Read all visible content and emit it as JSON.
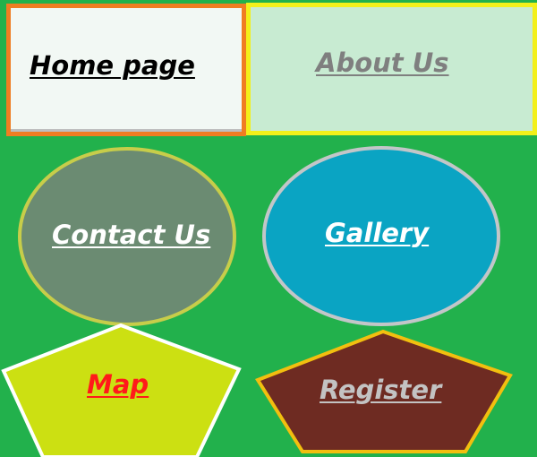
{
  "nav": {
    "home_label": "Home page",
    "about_label": "About Us",
    "contact_label": "Contact Us",
    "gallery_label": "Gallery",
    "map_label": "Map",
    "register_label": "Register"
  },
  "colors": {
    "background": "#22b14c",
    "home_fill": "#f2f8f4",
    "home_border": "#f07d22",
    "about_fill": "#c8ebd2",
    "about_border": "#f3f01a",
    "contact_fill": "#6b8b72",
    "gallery_fill": "#0aa4c3",
    "map_fill": "#cce012",
    "register_fill": "#6e2b22",
    "register_border": "#f2bf0f"
  }
}
